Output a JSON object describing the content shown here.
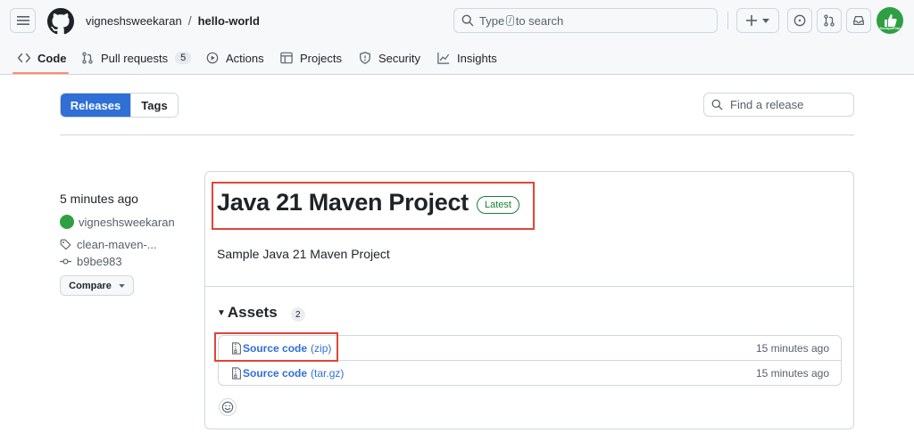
{
  "repo": {
    "owner": "vigneshsweekaran",
    "separator": "/",
    "name": "hello-world"
  },
  "search": {
    "prefix": "Type",
    "key": "/",
    "suffix": "to search"
  },
  "avatar_text": "DevopsPilot",
  "tabs": [
    {
      "label": "Code",
      "icon": "code-icon",
      "active": true
    },
    {
      "label": "Pull requests",
      "icon": "git-pull-request-icon",
      "count": "5"
    },
    {
      "label": "Actions",
      "icon": "play-icon"
    },
    {
      "label": "Projects",
      "icon": "table-icon"
    },
    {
      "label": "Security",
      "icon": "shield-icon"
    },
    {
      "label": "Insights",
      "icon": "graph-icon"
    }
  ],
  "subnav": {
    "releases": "Releases",
    "tags": "Tags",
    "find_placeholder": "Find a release"
  },
  "meta": {
    "time": "5 minutes ago",
    "author": "vigneshsweekaran",
    "tag": "clean-maven-...",
    "commit": "b9be983",
    "compare": "Compare"
  },
  "release": {
    "title": "Java 21 Maven Project",
    "badge": "Latest",
    "description": "Sample Java 21 Maven Project"
  },
  "assets": {
    "heading": "Assets",
    "count": "2",
    "items": [
      {
        "name": "Source code",
        "ext": "(zip)",
        "time": "15 minutes ago"
      },
      {
        "name": "Source code",
        "ext": "(tar.gz)",
        "time": "15 minutes ago"
      }
    ]
  },
  "colors": {
    "accent": "#2f6fd6",
    "highlight": "#e0453a",
    "latest": "#1a7f37",
    "tab_underline": "#fd8c73"
  }
}
